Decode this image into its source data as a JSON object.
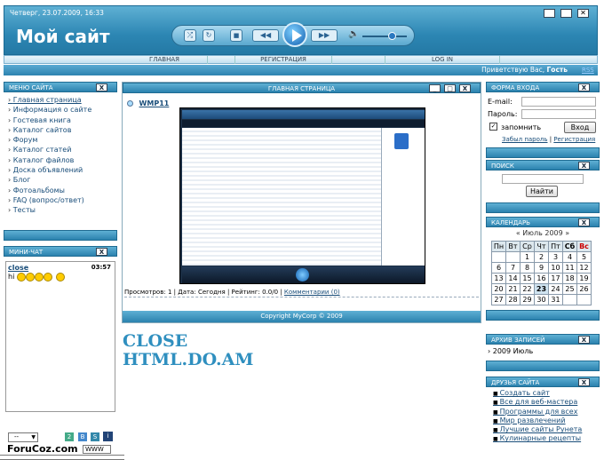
{
  "header": {
    "date": "Четверг, 23.07.2009, 16:33",
    "site_name": "Мой сайт",
    "greeting": "Приветствую Вас,",
    "guest": "Гость",
    "rss": "RSS"
  },
  "nav": {
    "items": [
      "ГЛАВНАЯ",
      "РЕГИСТРАЦИЯ",
      "LOG IN"
    ]
  },
  "menu": {
    "title": "МЕНЮ САЙТА",
    "items": [
      "Главная страница",
      "Информация о сайте",
      "Гостевая книга",
      "Каталог сайтов",
      "Форум",
      "Каталог статей",
      "Каталог файлов",
      "Доска объявлений",
      "Блог",
      "Фотоальбомы",
      "FAQ (вопрос/ответ)",
      "Тесты"
    ]
  },
  "chat": {
    "title": "МИНИ-ЧАТ",
    "user": "close",
    "time": "03:57",
    "msg": "hi"
  },
  "main": {
    "title": "ГЛАВНАЯ СТРАНИЦА",
    "post_title": "WMP11",
    "views_label": "Просмотров:",
    "views": "1",
    "date_label": "Дата:",
    "date": "Сегодня",
    "rating_label": "Рейтинг:",
    "rating": "0.0/0",
    "comments": "Комментарии (0)",
    "copyright": "Copyright MyCorp © 2009"
  },
  "banner": {
    "line1": "CLOSE",
    "line2": "HTML.DO.AM"
  },
  "login": {
    "title": "ФОРМА ВХОДА",
    "email_label": "E-mail:",
    "password_label": "Пароль:",
    "remember": "запомнить",
    "submit": "Вход",
    "forgot": "Забыл пароль",
    "register": "Регистрация"
  },
  "search": {
    "title": "ПОИСК",
    "button": "Найти"
  },
  "calendar": {
    "title": "КАЛЕНДАРЬ",
    "month": "Июль 2009",
    "prev": "«",
    "next": "»",
    "days": [
      "Пн",
      "Вт",
      "Ср",
      "Чт",
      "Пт",
      "Сб",
      "Вс"
    ],
    "weeks": [
      [
        "",
        "",
        "1",
        "2",
        "3",
        "4",
        "5"
      ],
      [
        "6",
        "7",
        "8",
        "9",
        "10",
        "11",
        "12"
      ],
      [
        "13",
        "14",
        "15",
        "16",
        "17",
        "18",
        "19"
      ],
      [
        "20",
        "21",
        "22",
        "23",
        "24",
        "25",
        "26"
      ],
      [
        "27",
        "28",
        "29",
        "30",
        "31",
        "",
        ""
      ]
    ]
  },
  "archive": {
    "title": "АРХИВ ЗАПИСЕЙ",
    "item": "2009 Июль"
  },
  "friends": {
    "title": "ДРУЗЬЯ САЙТА",
    "items": [
      "Создать сайт",
      "Все для веб-мастера",
      "Программы для всех",
      "Мир развлечений",
      "Лучшие сайты Рунета",
      "Кулинарные рецепты"
    ]
  },
  "footer": {
    "select": "--",
    "watermark": "ForuCoz.com",
    "www": "WWW"
  },
  "colors": {
    "accent": "#2b82ae",
    "link": "#1a4e7a",
    "banner": "#2f8fbf"
  }
}
